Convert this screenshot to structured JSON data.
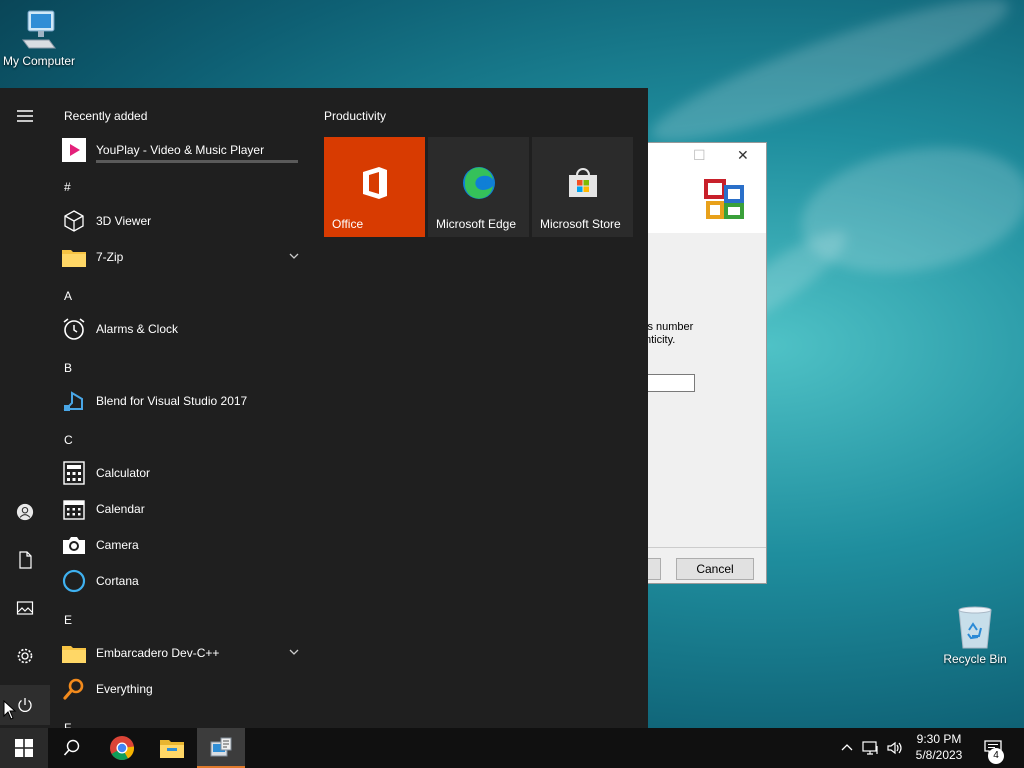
{
  "desktop": {
    "icons": [
      {
        "label": "My Computer"
      },
      {
        "label": "Recycle Bin"
      }
    ]
  },
  "dialog": {
    "text": "is number\nnticity.",
    "cancel_label": "Cancel"
  },
  "start_menu": {
    "recently_added_header": "Recently added",
    "tiles_header": "Productivity",
    "recent": [
      {
        "label": "YouPlay - Video & Music Player",
        "icon": "youplay-icon"
      }
    ],
    "sections": [
      {
        "letter": "#",
        "items": [
          {
            "label": "3D Viewer",
            "icon": "cube-icon"
          },
          {
            "label": "7-Zip",
            "icon": "folder-icon",
            "expandable": true
          }
        ]
      },
      {
        "letter": "A",
        "items": [
          {
            "label": "Alarms & Clock",
            "icon": "alarm-clock-icon"
          }
        ]
      },
      {
        "letter": "B",
        "items": [
          {
            "label": "Blend for Visual Studio 2017",
            "icon": "blend-icon"
          }
        ]
      },
      {
        "letter": "C",
        "items": [
          {
            "label": "Calculator",
            "icon": "calculator-icon"
          },
          {
            "label": "Calendar",
            "icon": "calendar-icon"
          },
          {
            "label": "Camera",
            "icon": "camera-icon"
          },
          {
            "label": "Cortana",
            "icon": "cortana-icon"
          }
        ]
      },
      {
        "letter": "E",
        "items": [
          {
            "label": "Embarcadero Dev-C++",
            "icon": "folder-icon",
            "expandable": true
          },
          {
            "label": "Everything",
            "icon": "magnifier-icon"
          }
        ]
      },
      {
        "letter": "F",
        "items": []
      }
    ],
    "tiles": [
      {
        "label": "Office",
        "color": "#d83b01",
        "icon": "office-icon"
      },
      {
        "label": "Microsoft Edge",
        "color": "#2b2b2b",
        "icon": "edge-icon"
      },
      {
        "label": "Microsoft Store",
        "color": "#2b2b2b",
        "icon": "store-icon"
      }
    ],
    "rail": [
      "hamburger-icon",
      "user-icon",
      "document-icon",
      "pictures-icon",
      "settings-icon",
      "power-icon"
    ]
  },
  "taskbar": {
    "time": "9:30 PM",
    "date": "5/8/2023",
    "notification_count": "4",
    "accent": "#e07a2c"
  }
}
